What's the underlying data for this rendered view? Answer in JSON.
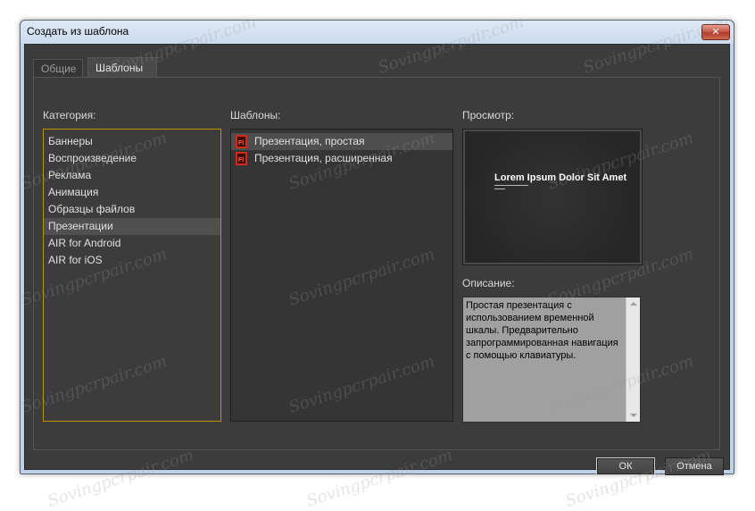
{
  "window": {
    "title": "Создать из шаблона",
    "close_label": "✕"
  },
  "tabs": [
    {
      "label": "Общие",
      "active": false
    },
    {
      "label": "Шаблоны",
      "active": true
    }
  ],
  "category": {
    "label": "Категория:",
    "items": [
      "Баннеры",
      "Воспроизведение",
      "Реклама",
      "Анимация",
      "Образцы файлов",
      "Презентации",
      "AIR for Android",
      "AIR for iOS"
    ],
    "selected": "Презентации"
  },
  "templates": {
    "label": "Шаблоны:",
    "items": [
      {
        "label": "Презентация, простая",
        "icon": "fla-file-icon"
      },
      {
        "label": "Презентация, расширенная",
        "icon": "fla-file-icon"
      }
    ],
    "selected": "Презентация, простая"
  },
  "preview": {
    "label": "Просмотр:",
    "title": "Lorem Ipsum Dolor Sit Amet"
  },
  "description": {
    "label": "Описание:",
    "text": "Простая презентация с использованием временной шкалы. Предварительно запрограммированная навигация с помощью клавиатуры."
  },
  "buttons": {
    "ok": "ОК",
    "cancel": "Отмена"
  },
  "watermark": "Sovingpcrpair.com",
  "colors": {
    "category_border": "#c29300",
    "dialog_bg": "#3c3c3c"
  }
}
